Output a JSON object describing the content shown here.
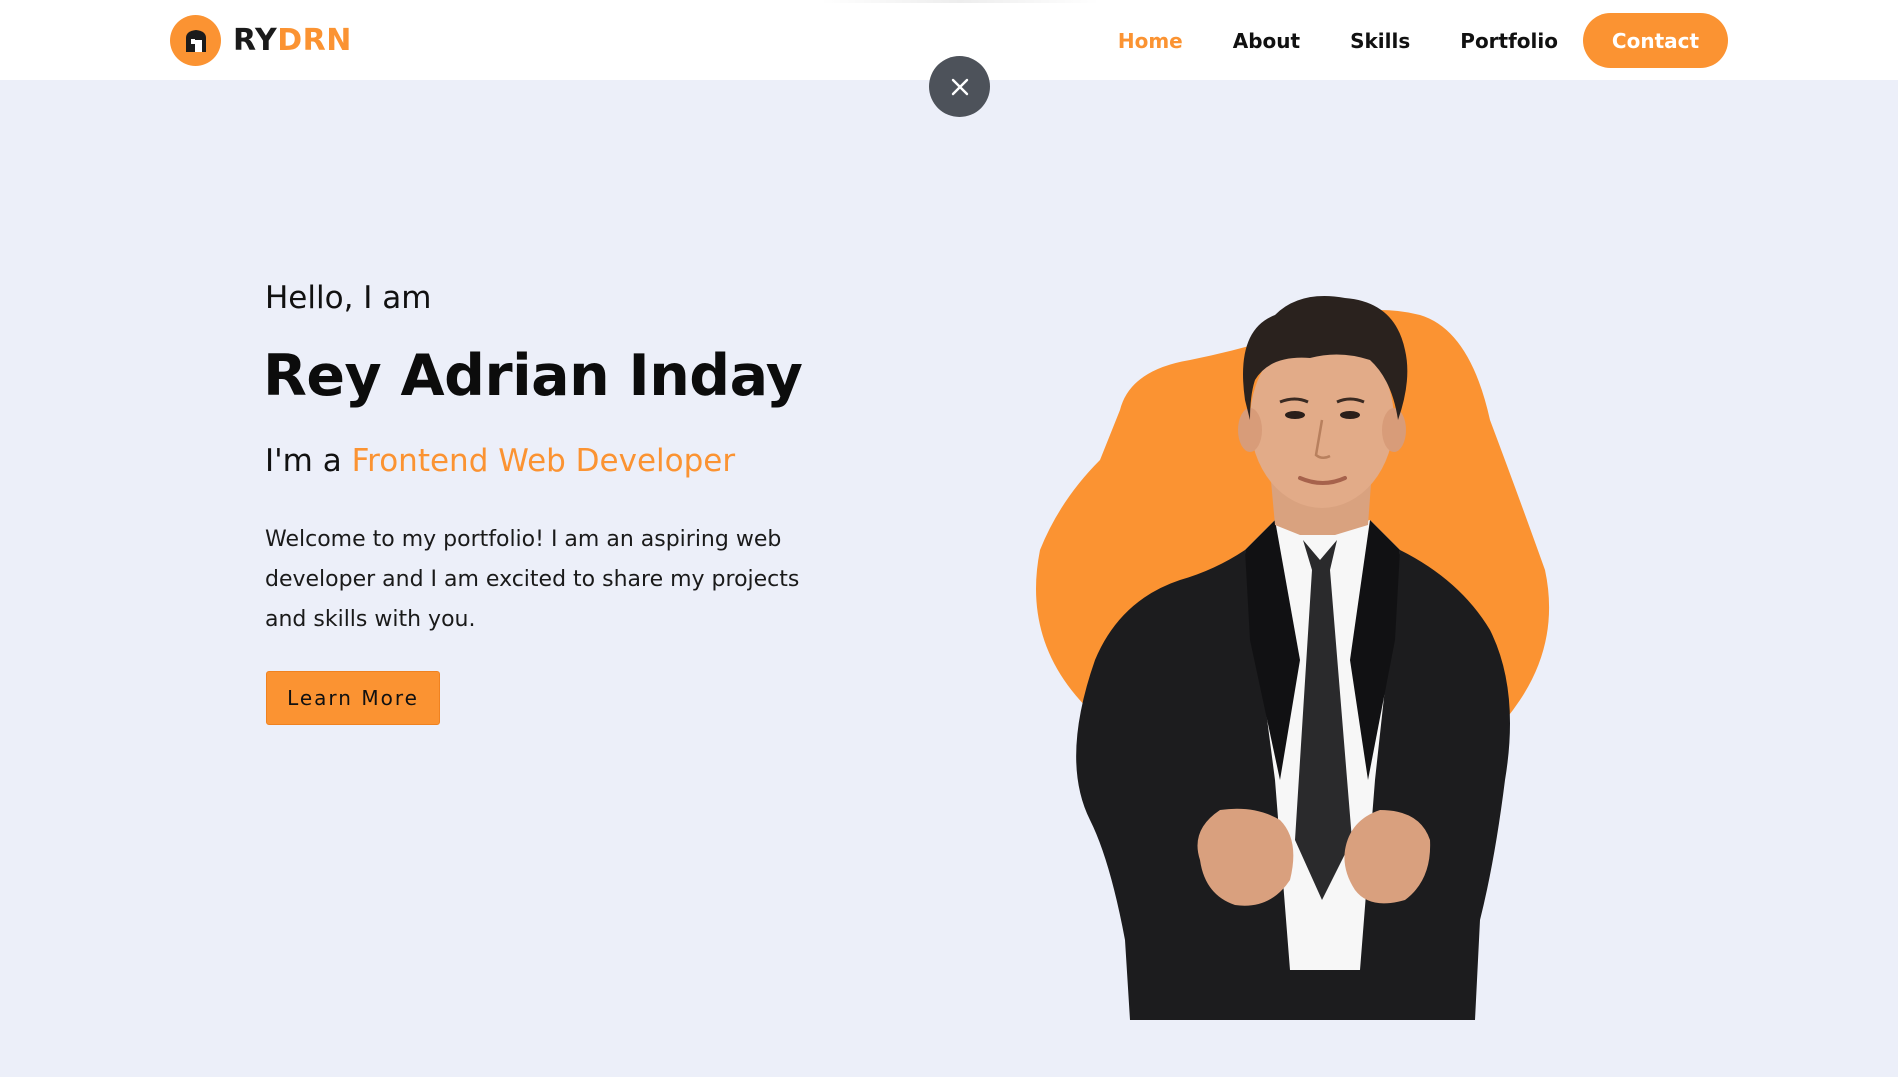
{
  "brand": {
    "prefix": "RY",
    "accent": "DRN",
    "logo_icon": "home-badge-icon"
  },
  "nav": {
    "items": [
      {
        "label": "Home",
        "active": true
      },
      {
        "label": "About",
        "active": false
      },
      {
        "label": "Skills",
        "active": false
      },
      {
        "label": "Portfolio",
        "active": false
      }
    ],
    "contact_label": "Contact"
  },
  "overlay": {
    "close_icon": "close-icon"
  },
  "hero": {
    "greeting": "Hello, I am",
    "name": "Rey Adrian Inday",
    "role_prefix": "I'm a ",
    "role_highlight": "Frontend Web Developer",
    "intro": "Welcome to my portfolio! I am an aspiring web developer and I am excited to share my projects and skills with you.",
    "cta_label": "Learn More",
    "portrait": "portrait-photo"
  },
  "colors": {
    "accent": "#fb9332",
    "hero_bg": "#eceff9",
    "text": "#111111",
    "close_bg": "#4d525a"
  }
}
